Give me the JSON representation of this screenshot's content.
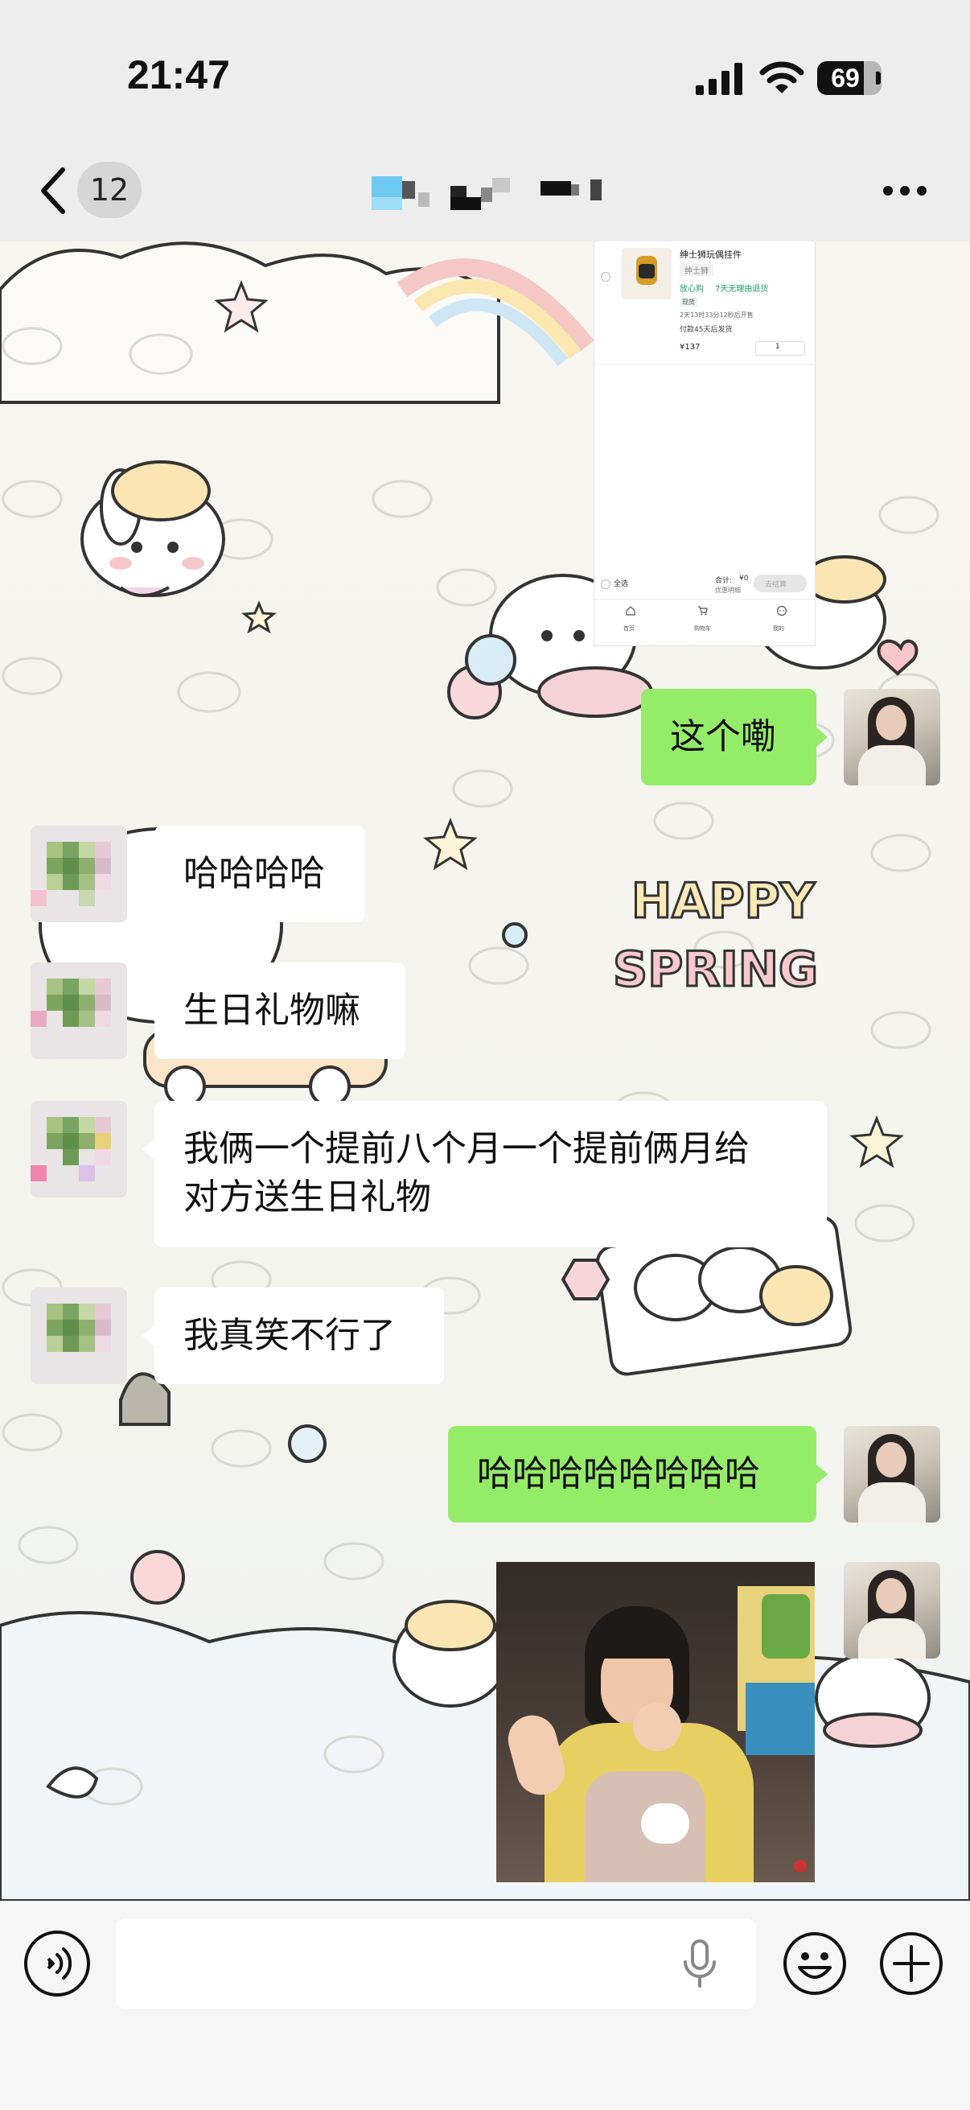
{
  "status_bar": {
    "time": "21:47",
    "battery_level": "69"
  },
  "nav": {
    "unread_count": "12",
    "icons": [
      "back-icon",
      "more-icon"
    ]
  },
  "screenshot_card": {
    "product_name": "绅士狮玩偶挂件",
    "variant": "绅士狮",
    "badge_text": "放心购",
    "return_policy": "7天无理由退货",
    "tag": "现货",
    "countdown": "2天13时33分12秒后开售",
    "ship_text": "付款45天后发货",
    "price": "¥137",
    "quantity": "1",
    "select_all": "全选",
    "total_label": "合计:",
    "total_value": "¥0",
    "discount_text": "优惠明细",
    "checkout_label": "去结算",
    "tabs": [
      "首页",
      "购物车",
      "我的"
    ]
  },
  "messages": [
    {
      "side": "me",
      "type": "image",
      "description_hidden": true
    },
    {
      "side": "me",
      "type": "text",
      "text": "这个嘞"
    },
    {
      "side": "other",
      "type": "text",
      "text": "哈哈哈哈"
    },
    {
      "side": "other",
      "type": "text",
      "text": "生日礼物嘛"
    },
    {
      "side": "other",
      "type": "text",
      "text": "我俩一个提前八个月一个提前俩月给对方送生日礼物",
      "lines": [
        "我俩一个提前八个月一个提前俩月给",
        "对方送生日礼物"
      ]
    },
    {
      "side": "other",
      "type": "text",
      "text": "我真笑不行了"
    },
    {
      "side": "me",
      "type": "text",
      "text": "哈哈哈哈哈哈哈哈"
    },
    {
      "side": "me",
      "type": "image"
    }
  ],
  "wallpaper_text": {
    "line1": "HAPPY",
    "line2": "SPRING"
  },
  "input_bar": {
    "placeholder": "",
    "icons": [
      "voice-icon",
      "mic-icon",
      "emoji-icon",
      "plus-icon"
    ]
  },
  "colors": {
    "my_bubble": "#95ec69",
    "other_bubble": "#ffffff",
    "background": "#ededed"
  }
}
